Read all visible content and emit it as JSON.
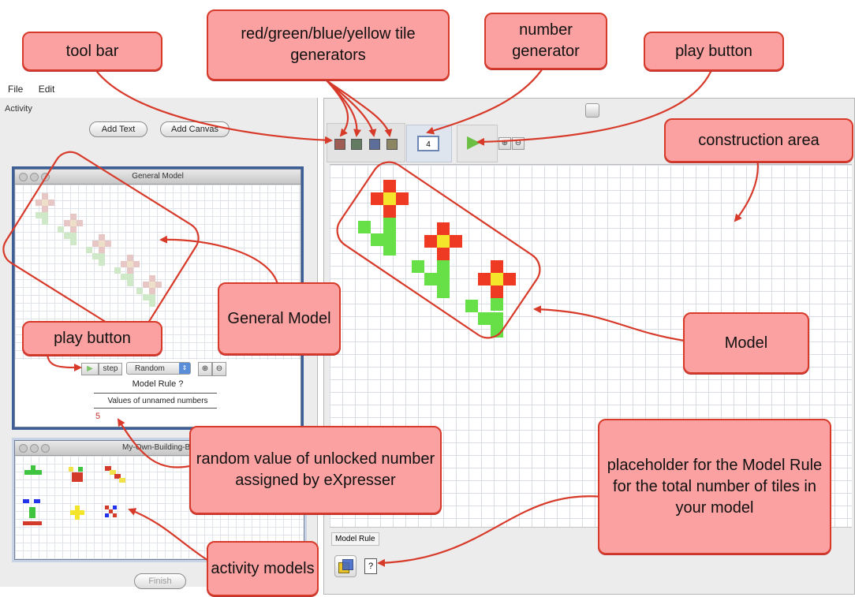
{
  "menu": {
    "file": "File",
    "edit": "Edit"
  },
  "sidebar": {
    "activity_label": "Activity",
    "add_text": "Add Text",
    "add_canvas": "Add Canvas",
    "finish": "Finish"
  },
  "general_model": {
    "title": "General Model",
    "play_symbol": "▶",
    "step": "step",
    "mode": "Random",
    "model_rule": "Model Rule ?",
    "values_label": "Values of unnamed numbers",
    "value": "5"
  },
  "building_blocks": {
    "title": "My-Own-Building-Blo"
  },
  "toolbar": {
    "number_value": "4",
    "play_symbol": "▶"
  },
  "model_rule_panel": {
    "label": "Model Rule",
    "placeholder": "?"
  },
  "colors": {
    "red": "#ee3a22",
    "green": "#66e046",
    "blue": "#2233ee",
    "yellow": "#f5e52a",
    "callout_fill": "#fba1a1",
    "callout_border": "#d83a2a"
  },
  "callouts": {
    "tool_bar": "tool bar",
    "tile_generators": "red/green/blue/yellow tile generators",
    "number_generator": "number generator",
    "play_button_top": "play button",
    "construction_area": "construction area",
    "general_model": "General Model",
    "model": "Model",
    "play_button_left": "play button",
    "random_value": "random value of unlocked number assigned by eXpresser",
    "placeholder": "placeholder for the Model Rule for the total number of tiles in your model",
    "activity_models": "activity models"
  }
}
